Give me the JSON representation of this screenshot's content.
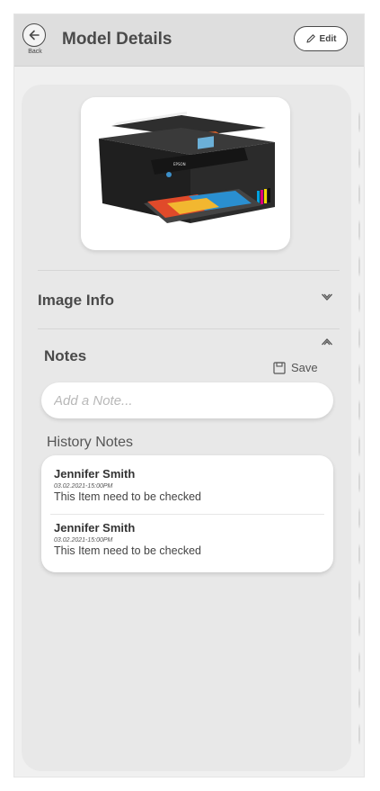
{
  "header": {
    "back_label": "Back",
    "title": "Model Details",
    "edit_label": "Edit"
  },
  "model_image": {
    "brand_label": "EPSON"
  },
  "image_info": {
    "title": "Image Info"
  },
  "notes": {
    "title": "Notes",
    "save_label": "Save",
    "placeholder": "Add a Note..."
  },
  "history": {
    "label": "History Notes",
    "items": [
      {
        "name": "Jennifer Smith",
        "date": "03.02.2021-15:00PM",
        "text": "This Item need to be checked"
      },
      {
        "name": "Jennifer Smith",
        "date": "03.02.2021-15:00PM",
        "text": "This Item need to be checked"
      }
    ]
  },
  "colors": {
    "header_bg": "#dedede",
    "card_bg": "#e8e8e8",
    "frame_bg": "#f0f0f0",
    "text_dark": "#4a4a4a"
  }
}
